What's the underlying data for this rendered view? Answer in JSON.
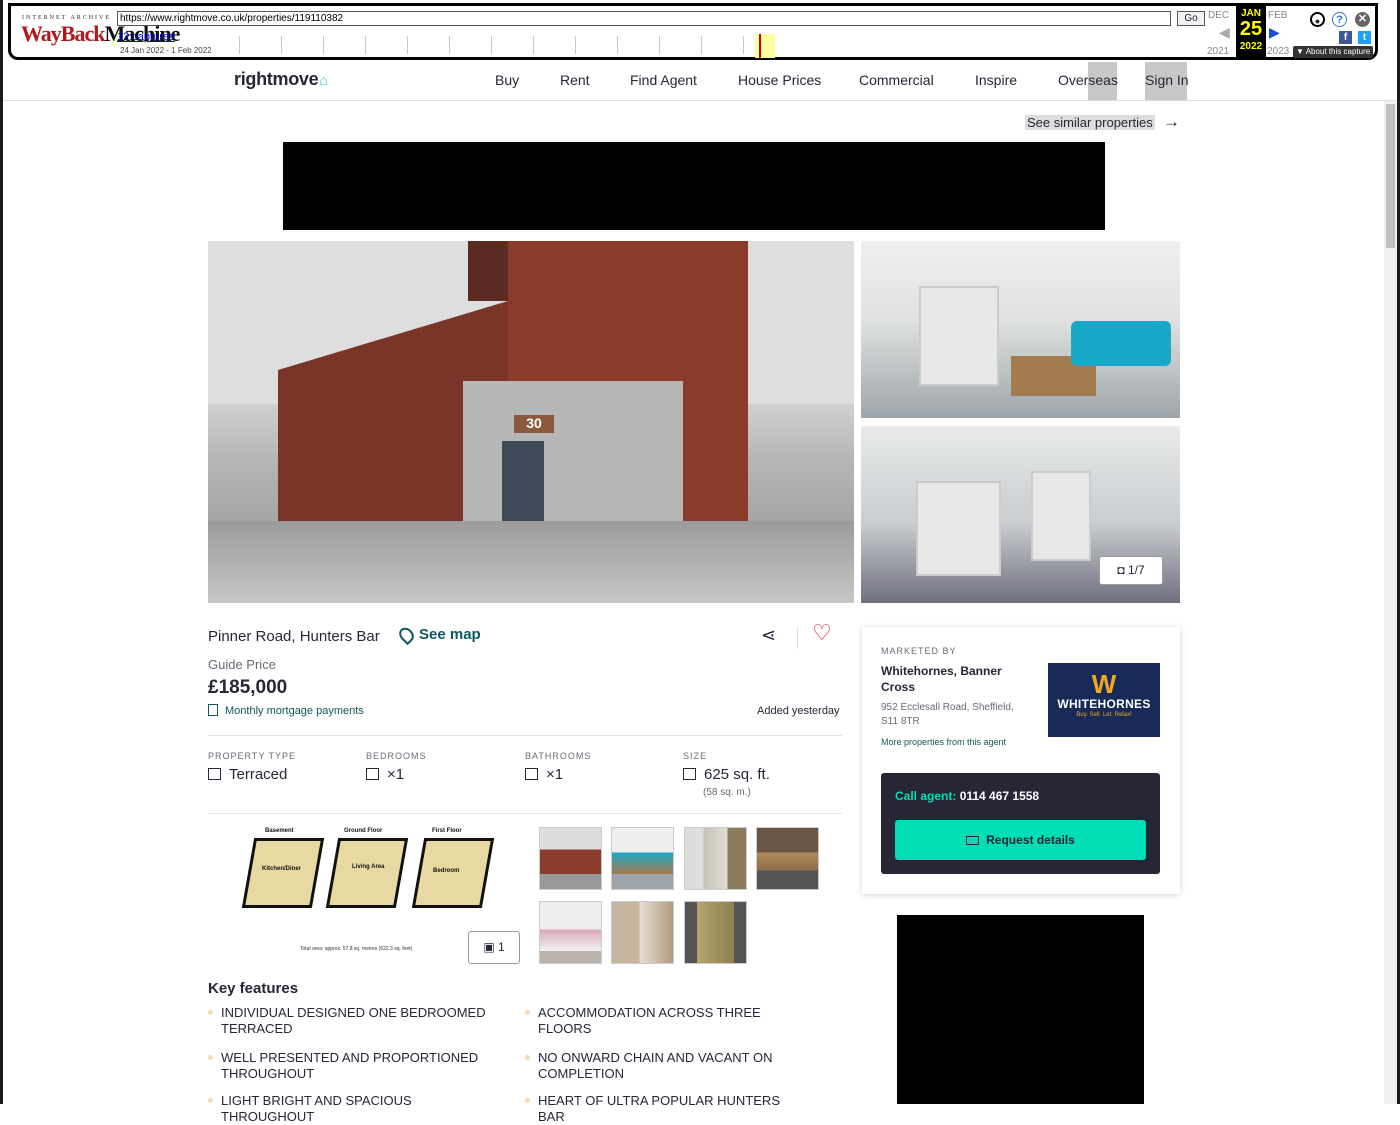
{
  "wayback": {
    "ia_label": "INTERNET ARCHIVE",
    "logo_w": "WayBack",
    "logo_m": "Machine",
    "url": "https://www.rightmove.co.uk/properties/119110382",
    "go": "Go",
    "captures": "12 captures",
    "range": "24 Jan 2022 - 1 Feb 2022",
    "prev_month": "DEC",
    "cur_month": "JAN",
    "next_month": "FEB",
    "day": "25",
    "prev_year": "2021",
    "cur_year": "2022",
    "next_year": "2023",
    "about": "▼ About this capture"
  },
  "header": {
    "logo": "rightmove",
    "nav": [
      "Buy",
      "Rent",
      "Find Agent",
      "House Prices",
      "Commercial",
      "Inspire",
      "Overseas",
      "Sign In"
    ]
  },
  "similar": "See similar properties",
  "gallery": {
    "house_number": "30",
    "counter": "1/7"
  },
  "property": {
    "address": "Pinner Road, Hunters Bar",
    "see_map": "See map",
    "price_qualifier": "Guide Price",
    "price": "£185,000",
    "mortgage": "Monthly mortgage payments",
    "added": "Added yesterday",
    "type_label": "PROPERTY TYPE",
    "type_value": "Terraced",
    "bed_label": "BEDROOMS",
    "bed_value": "×1",
    "bath_label": "BATHROOMS",
    "bath_value": "×1",
    "size_label": "SIZE",
    "size_value": "625 sq. ft.",
    "size_sub": "(58 sq. m.)",
    "floorplan_count": "1"
  },
  "floorplan": {
    "basement": "Basement",
    "ground": "Ground Floor",
    "first": "First Floor",
    "kitchen": "Kitchen/Diner",
    "living": "Living Area",
    "bedroom": "Bedroom",
    "total": "Total area: approx. 57.8 sq. metres (622.3 sq. feet)"
  },
  "features": {
    "title": "Key features",
    "items": [
      "INDIVIDUAL DESIGNED ONE BEDROOMED TERRACED",
      "ACCOMMODATION ACROSS THREE FLOORS",
      "WELL PRESENTED AND PROPORTIONED THROUGHOUT",
      "NO ONWARD CHAIN AND VACANT ON COMPLETION",
      "LIGHT BRIGHT AND SPACIOUS THROUGHOUT",
      "HEART OF ULTRA POPULAR HUNTERS BAR"
    ]
  },
  "agent": {
    "marketed_by": "MARKETED BY",
    "name": "Whitehornes, Banner Cross",
    "address": "952 Ecclesall Road, Sheffield, S11 8TR",
    "more": "More properties from this agent",
    "logo_mark": "W",
    "logo_name": "WHITEHORNES",
    "logo_tag": "Buy. Sell. Let. Relax!",
    "call_label": "Call agent:",
    "phone": "0114 467 1558",
    "request": "Request details"
  },
  "colors": {
    "brand": "#00deb6",
    "accent": "#0d585f",
    "heart": "#d21d3d"
  }
}
